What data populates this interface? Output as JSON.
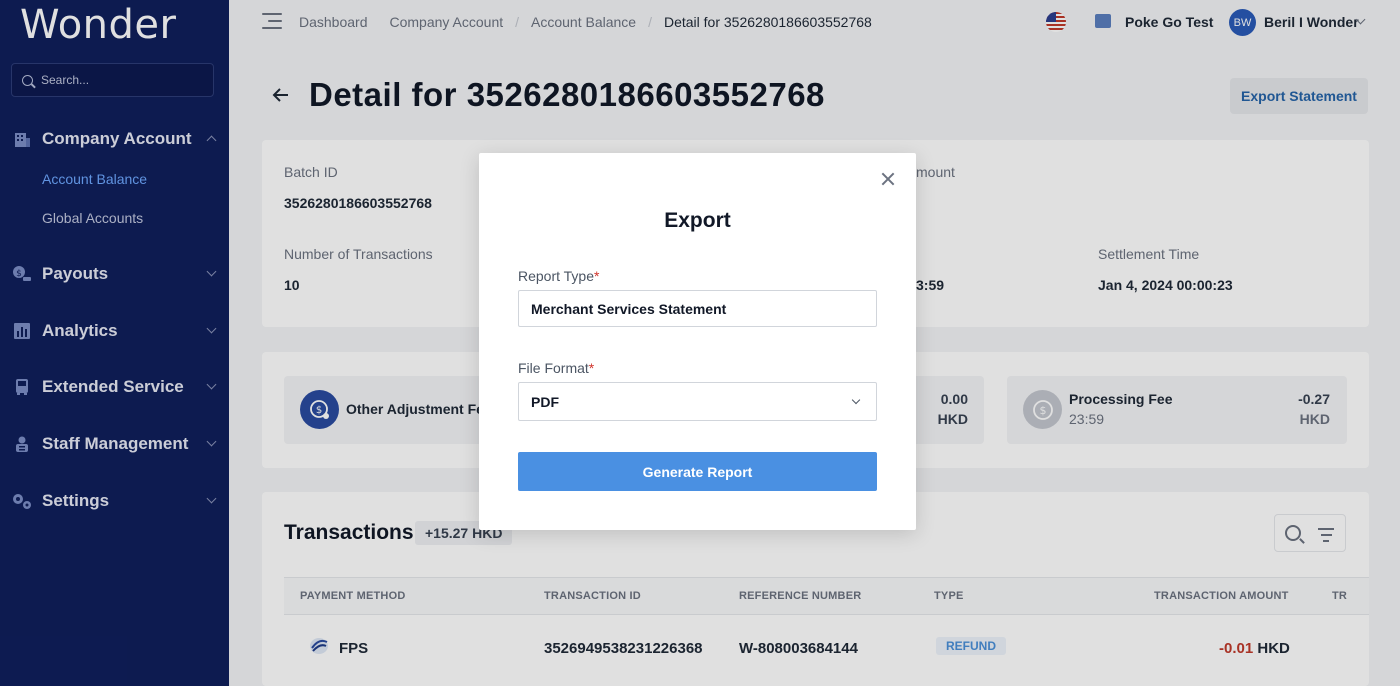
{
  "sidebar": {
    "logo": "Wonder",
    "search_placeholder": "Search...",
    "company_account": "Company Account",
    "sub_items": [
      "Account Balance",
      "Global Accounts"
    ],
    "payouts": "Payouts",
    "analytics": "Analytics",
    "extended_service": "Extended Service",
    "staff_management": "Staff Management",
    "settings": "Settings"
  },
  "topbar": {
    "crumbs": [
      "Dashboard",
      "Company Account",
      "Account Balance",
      "Detail for 3526280186603552768"
    ],
    "org_name": "Poke Go Test",
    "avatar_initials": "BW",
    "user_name": "Beril I Wonder"
  },
  "page": {
    "title": "Detail for 3526280186603552768",
    "export_label": "Export Statement"
  },
  "summary": {
    "batch_id_label": "Batch ID",
    "batch_id_value": "3526280186603552768",
    "amount_label_fragment": "mount",
    "num_tx_label": "Number of Transactions",
    "num_tx_value": "10",
    "time_fragment": "3:59",
    "settlement_label": "Settlement Time",
    "settlement_value": "Jan 4, 2024 00:00:23"
  },
  "fees": {
    "other_name": "Other Adjustment Fee",
    "mid_amount": "0.00",
    "mid_currency": "HKD",
    "processing_name": "Processing Fee",
    "processing_sub": "23:59",
    "processing_amount": "-0.27",
    "processing_currency": "HKD"
  },
  "transactions": {
    "title": "Transactions",
    "total_badge": "+15.27 HKD",
    "headers": [
      "PAYMENT METHOD",
      "TRANSACTION ID",
      "REFERENCE NUMBER",
      "TYPE",
      "TRANSACTION AMOUNT",
      "TR"
    ],
    "row": {
      "method": "FPS",
      "tx_id": "3526949538231226368",
      "reference": "W-808003684144",
      "type": "REFUND",
      "amount": "-0.01",
      "currency": "HKD"
    }
  },
  "modal": {
    "title": "Export",
    "report_type_label": "Report Type",
    "report_type_value": "Merchant Services Statement",
    "file_format_label": "File Format",
    "file_format_value": "PDF",
    "required_mark": "*",
    "generate_label": "Generate Report"
  },
  "colors": {
    "sidebar_bg": "#0f1f5c",
    "accent_blue": "#4a90e2",
    "negative_red": "#c0392b"
  }
}
